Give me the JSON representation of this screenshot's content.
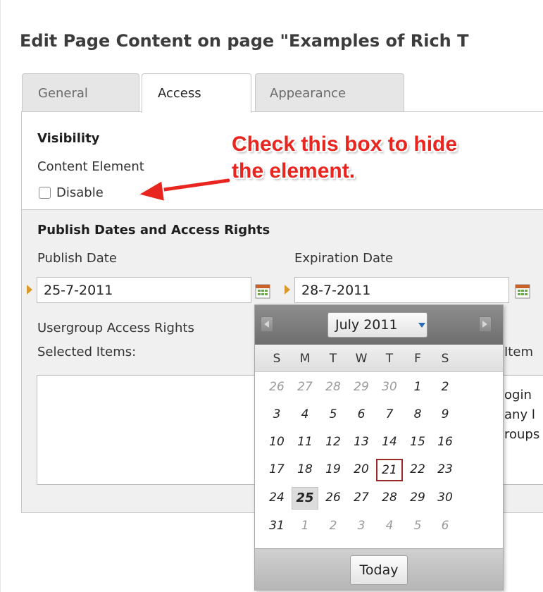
{
  "page": {
    "title": "Edit Page Content on page \"Examples of Rich T"
  },
  "tabs": [
    {
      "label": "General"
    },
    {
      "label": "Access"
    },
    {
      "label": "Appearance"
    }
  ],
  "visibility": {
    "heading": "Visibility",
    "field_label": "Content Element",
    "checkbox_label": "Disable",
    "checked": false
  },
  "annotation": {
    "line1": "Check this box to hide",
    "line2": "the element.",
    "color": "#e8251e"
  },
  "publish": {
    "heading": "Publish Dates and Access Rights",
    "publish_label": "Publish Date",
    "publish_value": "25-7-2011",
    "expiration_label": "Expiration Date",
    "expiration_value": "28-7-2011"
  },
  "access": {
    "usergroup_label": "Usergroup Access Rights",
    "selected_label": "Selected Items:",
    "available_label_fragment": "Item",
    "available_items_fragments": [
      "ogin",
      "any l",
      "roups"
    ]
  },
  "calendar": {
    "month_label": "July 2011",
    "weekday_headers": [
      "S",
      "M",
      "T",
      "W",
      "T",
      "F",
      "S"
    ],
    "weeks": [
      [
        "26",
        "27",
        "28",
        "29",
        "30",
        "1",
        "2"
      ],
      [
        "3",
        "4",
        "5",
        "6",
        "7",
        "8",
        "9"
      ],
      [
        "10",
        "11",
        "12",
        "13",
        "14",
        "15",
        "16"
      ],
      [
        "17",
        "18",
        "19",
        "20",
        "21",
        "22",
        "23"
      ],
      [
        "24",
        "25",
        "26",
        "27",
        "28",
        "29",
        "30"
      ],
      [
        "31",
        "1",
        "2",
        "3",
        "4",
        "5",
        "6"
      ]
    ],
    "selected_day": "25",
    "today_day": "21",
    "today_button": "Today"
  },
  "icons": {
    "calendar": "calendar-icon",
    "prev": "chevron-left-icon",
    "next": "chevron-right-icon",
    "required": "required-marker-icon",
    "arrow": "annotation-arrow-icon"
  },
  "colors": {
    "marker": "#d99a2b",
    "today_border": "#9d2a2a"
  }
}
